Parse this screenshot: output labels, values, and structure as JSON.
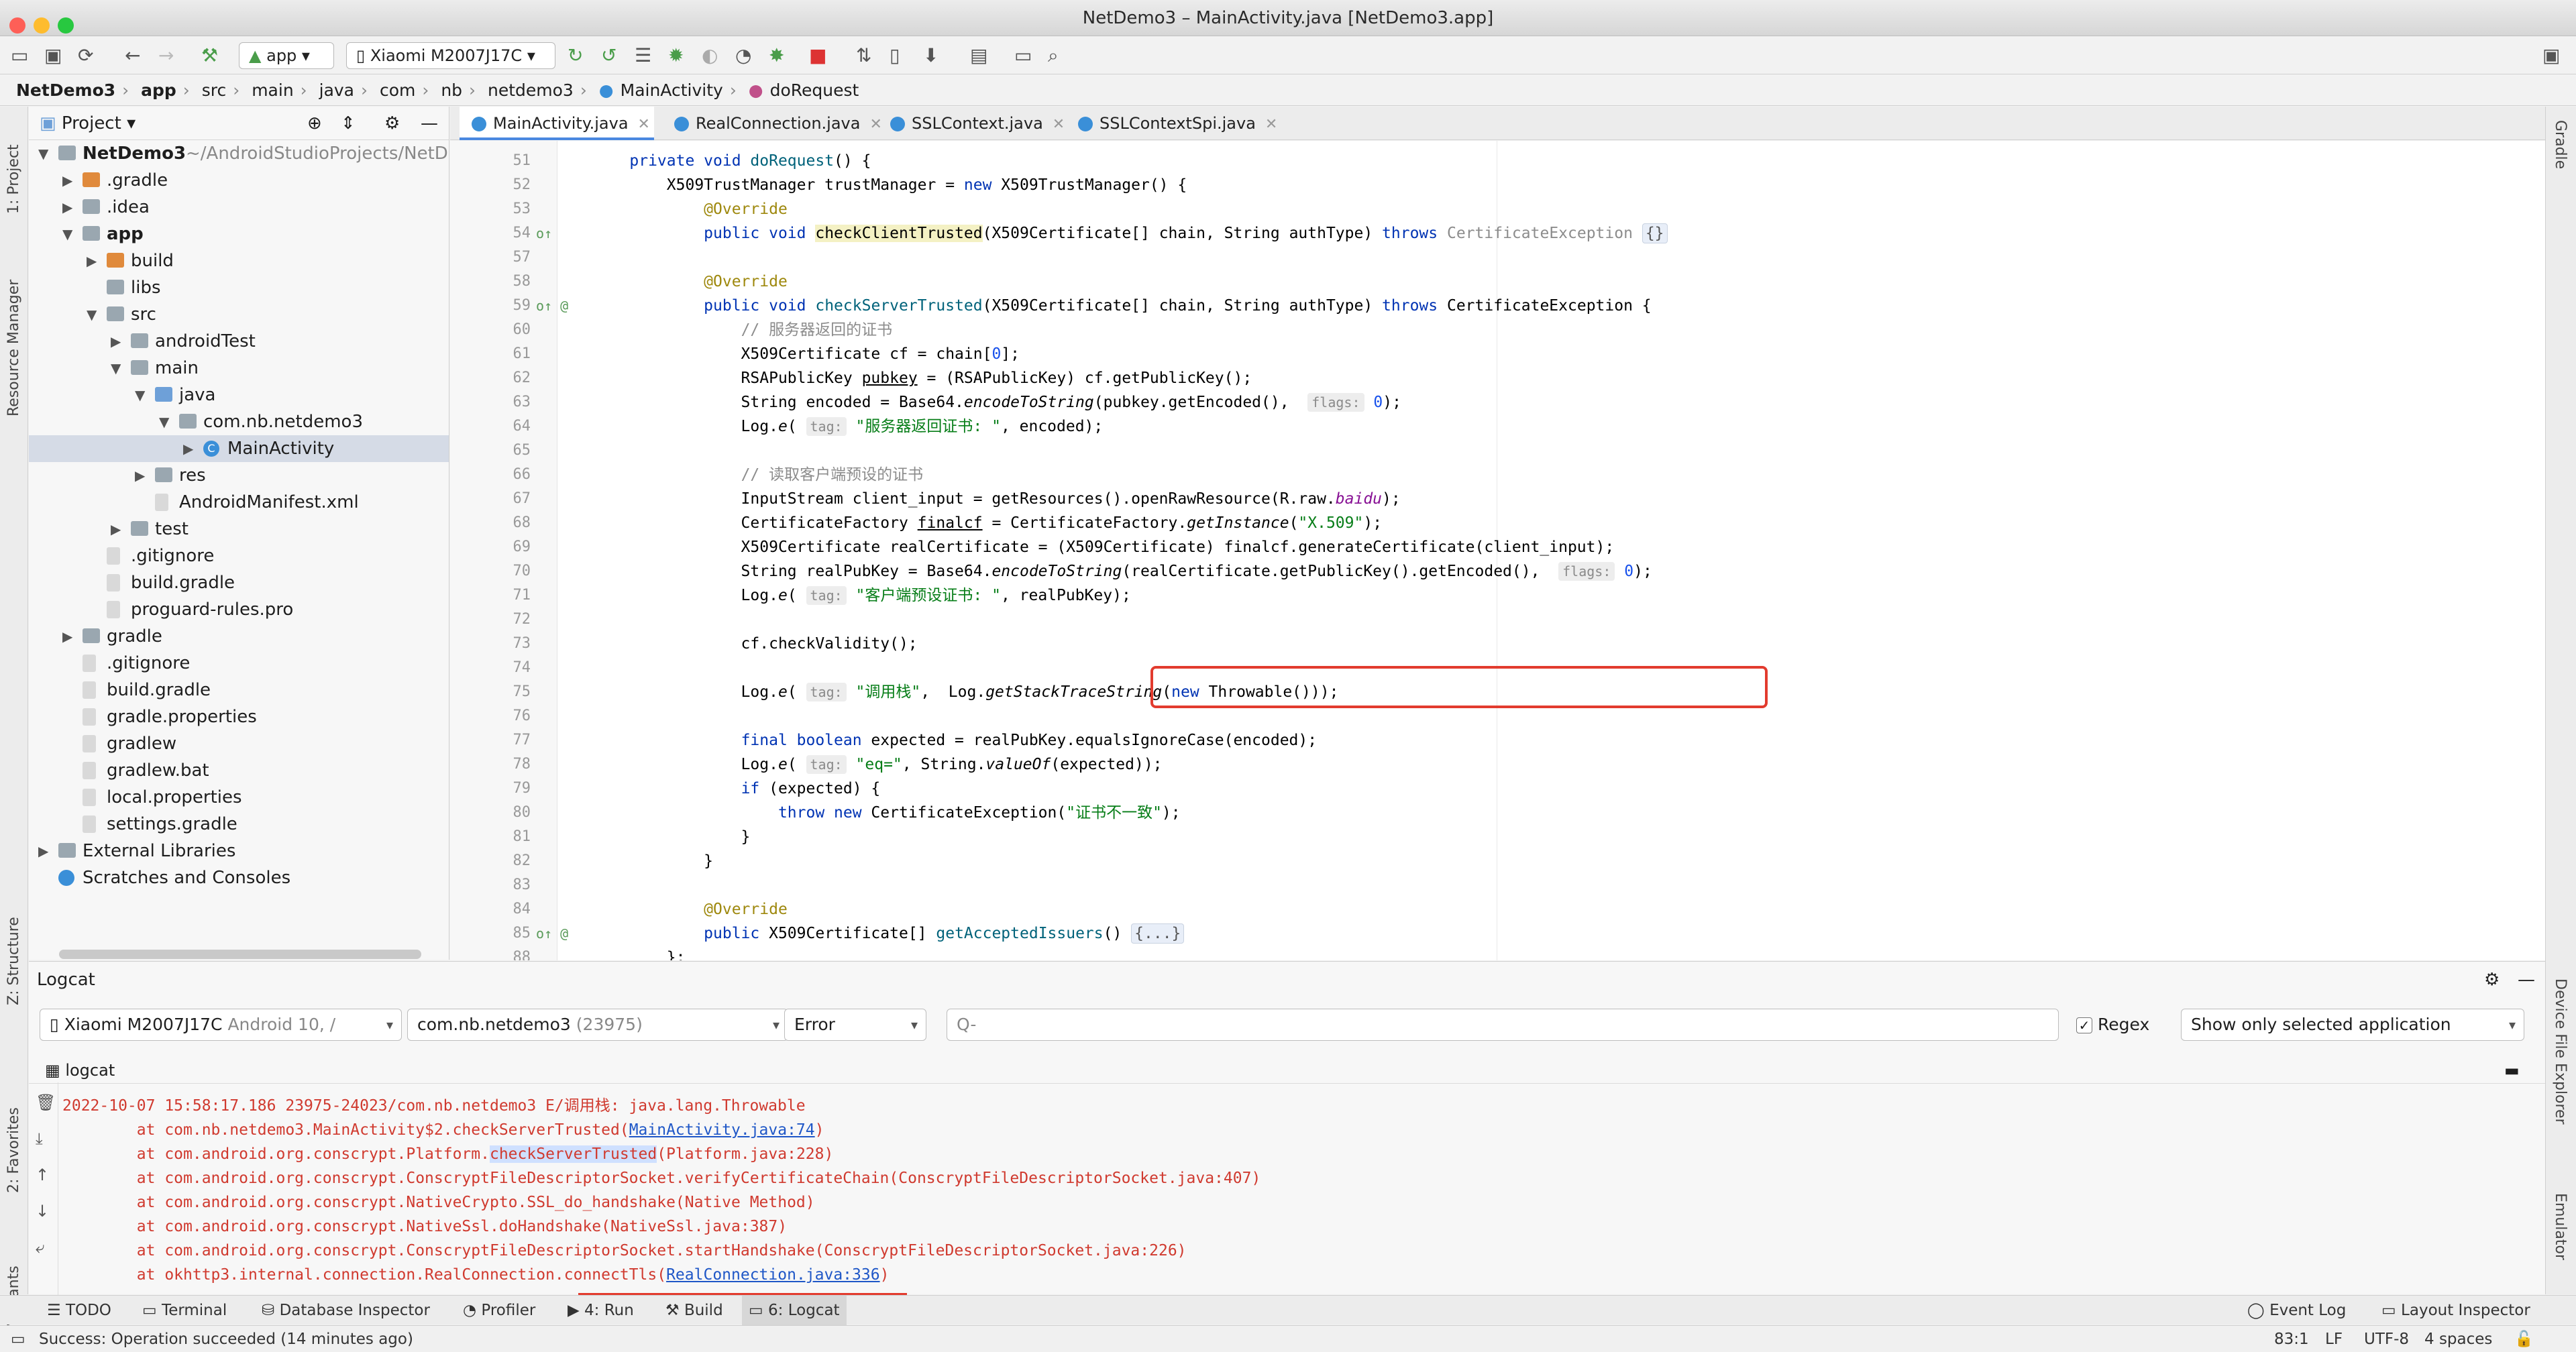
{
  "window": {
    "title": "NetDemo3 – MainActivity.java [NetDemo3.app]"
  },
  "toolbar": {
    "run_config": "app",
    "device": "Xiaomi M2007J17C"
  },
  "breadcrumb": [
    "NetDemo3",
    "app",
    "src",
    "main",
    "java",
    "com",
    "nb",
    "netdemo3",
    "MainActivity",
    "doRequest"
  ],
  "left_strip": {
    "project": "1: Project",
    "resource_manager": "Resource Manager",
    "structure": "Z: Structure",
    "favorites": "2: Favorites",
    "build_variants": "Build Variants"
  },
  "right_strip": {
    "gradle": "Gradle",
    "device_file_explorer": "Device File Explorer",
    "emulator": "Emulator"
  },
  "project_panel": {
    "title": "Project",
    "tree": [
      {
        "label": "NetDemo3",
        "extra": "~/AndroidStudioProjects/NetD",
        "level": 0,
        "open": true,
        "kind": "folder",
        "bold": true
      },
      {
        "label": ".gradle",
        "level": 1,
        "open": false,
        "kind": "folder-o"
      },
      {
        "label": ".idea",
        "level": 1,
        "open": false,
        "kind": "folder"
      },
      {
        "label": "app",
        "level": 1,
        "open": true,
        "kind": "folder",
        "bold": true
      },
      {
        "label": "build",
        "level": 2,
        "open": false,
        "kind": "folder-o"
      },
      {
        "label": "libs",
        "level": 2,
        "kind": "folder"
      },
      {
        "label": "src",
        "level": 2,
        "open": true,
        "kind": "folder"
      },
      {
        "label": "androidTest",
        "level": 3,
        "open": false,
        "kind": "folder"
      },
      {
        "label": "main",
        "level": 3,
        "open": true,
        "kind": "folder"
      },
      {
        "label": "java",
        "level": 4,
        "open": true,
        "kind": "folder-b"
      },
      {
        "label": "com.nb.netdemo3",
        "level": 5,
        "open": true,
        "kind": "folder"
      },
      {
        "label": "MainActivity",
        "level": 6,
        "open": false,
        "kind": "class",
        "selected": true
      },
      {
        "label": "res",
        "level": 4,
        "open": false,
        "kind": "folder"
      },
      {
        "label": "AndroidManifest.xml",
        "level": 4,
        "kind": "file"
      },
      {
        "label": "test",
        "level": 3,
        "open": false,
        "kind": "folder"
      },
      {
        "label": ".gitignore",
        "level": 2,
        "kind": "file"
      },
      {
        "label": "build.gradle",
        "level": 2,
        "kind": "file"
      },
      {
        "label": "proguard-rules.pro",
        "level": 2,
        "kind": "file"
      },
      {
        "label": "gradle",
        "level": 1,
        "open": false,
        "kind": "folder"
      },
      {
        "label": ".gitignore",
        "level": 1,
        "kind": "file"
      },
      {
        "label": "build.gradle",
        "level": 1,
        "kind": "file"
      },
      {
        "label": "gradle.properties",
        "level": 1,
        "kind": "file"
      },
      {
        "label": "gradlew",
        "level": 1,
        "kind": "file"
      },
      {
        "label": "gradlew.bat",
        "level": 1,
        "kind": "file"
      },
      {
        "label": "local.properties",
        "level": 1,
        "kind": "file"
      },
      {
        "label": "settings.gradle",
        "level": 1,
        "kind": "file"
      },
      {
        "label": "External Libraries",
        "level": 0,
        "open": false,
        "kind": "lib"
      },
      {
        "label": "Scratches and Consoles",
        "level": 0,
        "kind": "scratch"
      }
    ]
  },
  "editor_tabs": [
    {
      "label": "MainActivity.java",
      "active": true
    },
    {
      "label": "RealConnection.java",
      "active": false
    },
    {
      "label": "SSLContext.java",
      "active": false
    },
    {
      "label": "SSLContextSpi.java",
      "active": false
    }
  ],
  "code_lines": [
    {
      "n": "51",
      "html": "    <span class='kw'>private void</span> <span class='fn'>doRequest</span>() {"
    },
    {
      "n": "52",
      "html": "        X509TrustManager trustManager = <span class='kw'>new</span> X509TrustManager() {"
    },
    {
      "n": "53",
      "html": "            <span class='an'>@Override</span>"
    },
    {
      "n": "54",
      "g": "o↑",
      "html": "            <span class='kw'>public void</span> <span class='hl'>checkClientTrusted</span>(X509Certificate[] chain, String authType) <span class='kw'>throws</span> <span class='cm'>CertificateException</span> <span class='fold'>{}</span>"
    },
    {
      "n": "57",
      "html": ""
    },
    {
      "n": "58",
      "html": "            <span class='an'>@Override</span>"
    },
    {
      "n": "59",
      "g": "o↑ @",
      "html": "            <span class='kw'>public void</span> <span class='fn'>checkServerTrusted</span>(X509Certificate[] chain, String authType) <span class='kw'>throws</span> CertificateException {"
    },
    {
      "n": "60",
      "html": "                <span class='cm'>// 服务器返回的证书</span>"
    },
    {
      "n": "61",
      "html": "                X509Certificate cf = chain[<span class='num'>0</span>];"
    },
    {
      "n": "62",
      "html": "                RSAPublicKey <u>pubkey</u> = (RSAPublicKey) cf.getPublicKey();"
    },
    {
      "n": "63",
      "html": "                String encoded = Base64.<span class='it'>encodeToString</span>(pubkey.getEncoded(),  <span class='hint'>flags:</span> <span class='num'>0</span>);"
    },
    {
      "n": "64",
      "html": "                Log.<span class='it'>e</span>( <span class='hint'>tag:</span> <span class='st'>\"服务器返回证书: \"</span>, encoded);"
    },
    {
      "n": "65",
      "html": ""
    },
    {
      "n": "66",
      "html": "                <span class='cm'>// 读取客户端预设的证书</span>"
    },
    {
      "n": "67",
      "html": "                InputStream client_input = getResources().openRawResource(R.raw.<span class='it' style='color:#871094'>baidu</span>);"
    },
    {
      "n": "68",
      "html": "                CertificateFactory <u>finalcf</u> = CertificateFactory.<span class='it'>getInstance</span>(<span class='st'>\"X.509\"</span>);"
    },
    {
      "n": "69",
      "html": "                X509Certificate realCertificate = (X509Certificate) finalcf.generateCertificate(client_input);"
    },
    {
      "n": "70",
      "html": "                String realPubKey = Base64.<span class='it'>encodeToString</span>(realCertificate.getPublicKey().getEncoded(),  <span class='hint'>flags:</span> <span class='num'>0</span>);"
    },
    {
      "n": "71",
      "html": "                Log.<span class='it'>e</span>( <span class='hint'>tag:</span> <span class='st'>\"客户端预设证书: \"</span>, realPubKey);"
    },
    {
      "n": "72",
      "html": ""
    },
    {
      "n": "73",
      "html": "                cf.checkValidity();"
    },
    {
      "n": "74",
      "html": ""
    },
    {
      "n": "75",
      "html": "                Log.<span class='it'>e</span>( <span class='hint'>tag:</span> <span class='st'>\"调用栈\"</span>,  Log.<span class='it'>getStackTraceString</span>(<span class='kw'>new</span> Throwable()));"
    },
    {
      "n": "76",
      "html": ""
    },
    {
      "n": "77",
      "html": "                <span class='kw'>final boolean</span> expected = realPubKey.equalsIgnoreCase(encoded);"
    },
    {
      "n": "78",
      "html": "                Log.<span class='it'>e</span>( <span class='hint'>tag:</span> <span class='st'>\"eq=\"</span>, String.<span class='it'>valueOf</span>(expected));"
    },
    {
      "n": "79",
      "html": "                <span class='kw'>if</span> (expected) {"
    },
    {
      "n": "80",
      "html": "                    <span class='kw'>throw new</span> CertificateException(<span class='st'>\"证书不一致\"</span>);"
    },
    {
      "n": "81",
      "html": "                }"
    },
    {
      "n": "82",
      "html": "            }"
    },
    {
      "n": "83",
      "html": ""
    },
    {
      "n": "84",
      "html": "            <span class='an'>@Override</span>"
    },
    {
      "n": "85",
      "g": "o↑ @",
      "html": "            <span class='kw'>public</span> X509Certificate[] <span class='fn'>getAcceptedIssuers</span>() <span class='fold'>{...}</span>"
    },
    {
      "n": "88",
      "html": "        };"
    }
  ],
  "logcat": {
    "title": "Logcat",
    "device": "Xiaomi M2007J17C",
    "device_extra": "Android 10, /",
    "process": "com.nb.netdemo3",
    "process_extra": "(23975)",
    "level": "Error",
    "search_placeholder": "Q-",
    "regex_label": "Regex",
    "filter_option": "Show only selected application",
    "sub_label": "logcat",
    "lines": [
      {
        "html": "2022-10-07 15:58:17.186 23975-24023/com.nb.netdemo3 E/调用栈: java.lang.Throwable"
      },
      {
        "html": "        at com.nb.netdemo3.MainActivity$2.checkServerTrusted(<a>MainActivity.java:74</a>)"
      },
      {
        "html": "        at com.android.org.conscrypt.Platform.<span class='hlw'>checkServerTrusted</span>(Platform.java:228)"
      },
      {
        "html": "        at com.android.org.conscrypt.ConscryptFileDescriptorSocket.verifyCertificateChain(ConscryptFileDescriptorSocket.java:407)"
      },
      {
        "html": "        at com.android.org.conscrypt.NativeCrypto.SSL_do_handshake(Native Method)"
      },
      {
        "html": "        at com.android.org.conscrypt.NativeSsl.doHandshake(NativeSsl.java:387)"
      },
      {
        "html": "        at com.android.org.conscrypt.ConscryptFileDescriptorSocket.startHandshake(ConscryptFileDescriptorSocket.java:226)"
      },
      {
        "html": "        at okhttp3.internal.connection.RealConnection.connectTls(<a>RealConnection.java:336</a>)"
      }
    ]
  },
  "bottom_tabs": [
    {
      "label": "TODO"
    },
    {
      "label": "Terminal"
    },
    {
      "label": "Database Inspector"
    },
    {
      "label": "Profiler"
    },
    {
      "label": "4: Run"
    },
    {
      "label": "Build"
    },
    {
      "label": "6: Logcat",
      "active": true
    }
  ],
  "bottom_right": {
    "event_log": "Event Log",
    "layout_inspector": "Layout Inspector"
  },
  "status": {
    "message": "Success: Operation succeeded (14 minutes ago)",
    "position": "83:1",
    "line_sep": "LF",
    "encoding": "UTF-8",
    "indent": "4 spaces"
  },
  "colors": {
    "accent": "#4a88e0",
    "highlight_box": "#e23b2e",
    "log_error": "#d03a2f"
  }
}
